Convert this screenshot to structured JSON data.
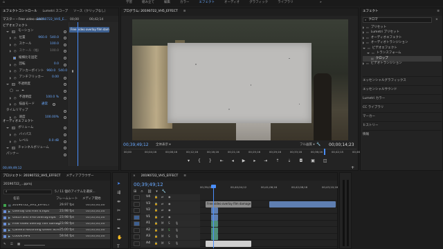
{
  "workspace": {
    "tabs": [
      "学習",
      "組み立て",
      "編集",
      "カラー",
      "エフェクト",
      "オーディオ",
      "グラフィック",
      "ライブラリ"
    ],
    "active_tab": "エフェクト",
    "more_icon": "double-chevron-right-icon"
  },
  "effect_controls": {
    "tabs": [
      "エフェクトコントロール",
      "Lumetri スコープ",
      "ソース（クリップなし）"
    ],
    "source_line": "マスター・Free video overl...",
    "sequence_line": "20190722_VH5_E...",
    "timecodes": [
      "00;00",
      "00;42;14"
    ],
    "clip_tooltip": "Free video overlay film damage effec",
    "sections": {
      "video": "ビデオエフェクト",
      "audio": "オーディオエフェクト"
    },
    "rows": [
      {
        "label": "モーション",
        "indent": 1,
        "type": "fx"
      },
      {
        "label": "位置",
        "value": "960.0",
        "value2": "540.0",
        "indent": 2
      },
      {
        "label": "スケール",
        "value": "100.0",
        "indent": 2
      },
      {
        "label": "スケール（幅）",
        "value": "100.0",
        "indent": 2,
        "dim": true
      },
      {
        "label": "縦横比を固定",
        "indent": 3,
        "type": "check"
      },
      {
        "label": "回転",
        "value": "0.0",
        "indent": 2
      },
      {
        "label": "アンカーポイント",
        "value": "960.0",
        "value2": "540.0",
        "indent": 2
      },
      {
        "label": "アンチフリッカー",
        "value": "0.00",
        "indent": 2
      },
      {
        "label": "不透明度",
        "indent": 1,
        "type": "fx"
      },
      {
        "label": "",
        "indent": 2,
        "type": "masks"
      },
      {
        "label": "不透明度",
        "value": "100.0 %",
        "indent": 2
      },
      {
        "label": "描画モード",
        "value": "通常",
        "indent": 2
      },
      {
        "label": "タイムリマップ",
        "indent": 1
      },
      {
        "label": "速度",
        "value": "100.00%",
        "indent": 2
      },
      {
        "label": "ボリューム",
        "indent": 1,
        "type": "fx"
      },
      {
        "label": "バイパス",
        "indent": 2,
        "type": "check"
      },
      {
        "label": "レベル",
        "value": "0.0 dB",
        "indent": 2
      },
      {
        "label": "チャンネルボリューム",
        "indent": 1,
        "type": "fx"
      },
      {
        "label": "パンナー",
        "indent": 1
      }
    ],
    "bottom_timecode": "00;49;49;12"
  },
  "program_monitor": {
    "title": "プログラム: 20190722_VH5_EFFECT",
    "current_timecode": "00;39;49;12",
    "fit": "全体表示",
    "quality": "フル画質",
    "duration": "00;00;14;23",
    "ruler_labels": [
      "00;00",
      "00;04;16",
      "00;08;16",
      "00;12;16",
      "00;16;16",
      "00;21;16",
      "00;25;16",
      "00;29;16",
      "00;33;16",
      "00;36;16",
      "00;42;15",
      "00;46;15"
    ],
    "playhead_fraction": 0.86
  },
  "effects_panel": {
    "title": "エフェクト",
    "search_value": "クロマ",
    "tree": [
      {
        "label": "プリセット",
        "indent": 0
      },
      {
        "label": "Lumetri プリセット",
        "indent": 0
      },
      {
        "label": "オーディオエフェクト",
        "indent": 0
      },
      {
        "label": "オーディオトランジション",
        "indent": 0
      },
      {
        "label": "ビデオエフェクト",
        "indent": 0,
        "open": true
      },
      {
        "label": "トランスフォーム",
        "indent": 1,
        "open": true
      },
      {
        "label": "クロップ",
        "indent": 2,
        "selected": true
      },
      {
        "label": "ビデオトランジション",
        "indent": 0
      }
    ],
    "panels": [
      "エッセンシャルグラフィックス",
      "エッセンシャルサウンド",
      "Lumetri カラー",
      "CC ライブラリ",
      "マーカー",
      "ヒストリー",
      "情報"
    ]
  },
  "project": {
    "tabs": [
      "プロジェクト: 20190722_VH5_EFFECT",
      "メディアブラウザー"
    ],
    "file": "20190722_...pproj",
    "item_count": "5 / 11 個のアイテムを選択...",
    "columns": [
      "名前",
      "フレームレート",
      "メディア開始"
    ],
    "items": [
      {
        "name": "20190722_VH5_EFFECT",
        "fps": "29.97 fps",
        "start": "00;00;00;00",
        "color": "#3fa34d"
      },
      {
        "name": "Overlay Old Film 4.mp4",
        "fps": "23.98 fps",
        "start": "00;00;00;00",
        "color": "#6a8fd8"
      },
      {
        "name": "Glitch and VHS overlay.mp4",
        "fps": "23.98 fps",
        "start": "00;00;00;00",
        "color": "#6a8fd8"
      },
      {
        "name": "Free video overlay film damage",
        "fps": "23.98 fps",
        "start": "00;00;00;00",
        "color": "#6a8fd8"
      },
      {
        "name": "Camera Recording Green Scree",
        "fps": "25.00 fps",
        "start": "00;00;00;00",
        "color": "#6a8fd8"
      },
      {
        "name": "C0004.MP4",
        "fps": "59.94 fps",
        "start": "00;00;00;00",
        "color": "#6a8fd8"
      }
    ]
  },
  "timeline": {
    "tab": "20190722_VH5_EFFECT",
    "timecode": "00;39;49;12",
    "ruler_labels": [
      "00;39;01;2",
      "00;40;04;12",
      "00;41;06;16",
      "00;42;08;16",
      "00;43;10;16"
    ],
    "video_tracks": [
      "V4",
      "V3",
      "V2",
      "V1"
    ],
    "audio_tracks": [
      "A1",
      "A2",
      "A3",
      "A4"
    ],
    "clip_label": "Free video overlay film damage"
  }
}
